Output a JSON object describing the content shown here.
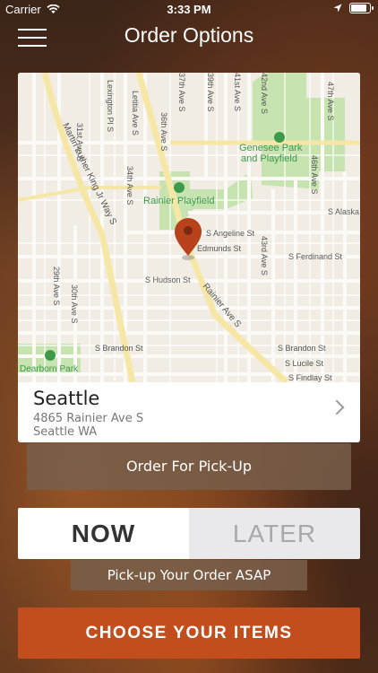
{
  "status_bar": {
    "carrier": "Carrier",
    "time": "3:33 PM",
    "icons": [
      "wifi-icon",
      "location-arrow-icon",
      "battery-icon"
    ],
    "battery_level": 0.95
  },
  "header": {
    "title": "Order Options",
    "menu_icon": "hamburger-menu-icon"
  },
  "map": {
    "labels": {
      "genesee": "Genesee Park",
      "genesee2": "and Playfield",
      "rainier_playfield": "Rainier Playfield",
      "dearborn": "Dearborn Park",
      "mlk": "Martin Luther King Jr Way S",
      "rainier_ave": "Rainier Ave S",
      "lexington": "Lexington Pl S",
      "letitia": "Letitia Ave S",
      "s31": "31st Ave S",
      "s34": "34th Ave S",
      "s36": "36th Ave S",
      "s37": "37th Ave S",
      "s39": "39th Ave S",
      "s41": "41st Ave S",
      "s42": "42nd Ave S",
      "s43": "43rd Ave S",
      "s46": "46th Ave S",
      "s47": "47th Ave S",
      "s29": "29th Ave S",
      "s30": "30th Ave S",
      "angeline": "S Angeline St",
      "edmunds": "Edmunds St",
      "ferdinand": "S Ferdinand St",
      "hudson": "S Hudson St",
      "brandon_w": "S Brandon St",
      "brandon_e": "S Brandon St",
      "lucile": "S Lucile St",
      "findlay": "S Findlay St",
      "alaska": "S Alaska"
    },
    "pin_icon": "map-pin-icon",
    "colors": {
      "park": "#c6e3b0",
      "road_major": "#f7e7a7",
      "pin": "#b8421b"
    }
  },
  "location": {
    "city": "Seattle",
    "address_line1": "4865 Rainier Ave S",
    "address_line2": "Seattle WA",
    "chevron_icon": "chevron-right-icon"
  },
  "order_type": {
    "label": "Order For Pick-Up"
  },
  "time_toggle": {
    "now": "NOW",
    "later": "LATER",
    "selected": "NOW"
  },
  "asap_note": "Pick-up Your Order ASAP",
  "cta": {
    "label": "CHOOSE YOUR ITEMS",
    "color": "#c24e1e"
  }
}
